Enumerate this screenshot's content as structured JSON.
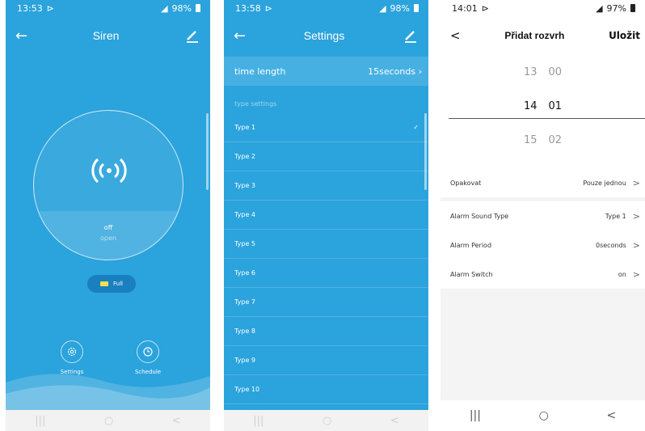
{
  "screen1": {
    "status_time": "13:53",
    "status_right": "98%",
    "title": "Siren",
    "state_main": "off",
    "state_sub": "open",
    "battery_label": "Full",
    "settings_label": "Settings",
    "schedule_label": "Schedule"
  },
  "screen2": {
    "status_time": "13:58",
    "status_right": "98%",
    "title": "Settings",
    "time_length_label": "time length",
    "time_length_value": "15seconds",
    "section_label": "type settings",
    "types": [
      "Type 1",
      "Type 2",
      "Type 3",
      "Type 4",
      "Type 5",
      "Type 6",
      "Type 7",
      "Type 8",
      "Type 9",
      "Type 10"
    ],
    "checkmark": "✓"
  },
  "screen3": {
    "status_time": "14:01",
    "status_right": "97%",
    "title": "Přidat rozvrh",
    "save_label": "Uložit",
    "picker": {
      "top": {
        "h": "13",
        "m": "00"
      },
      "selected": {
        "h": "14",
        "m": "01"
      },
      "bottom": {
        "h": "15",
        "m": "02"
      }
    },
    "repeat_label": "Opakovat",
    "repeat_value": "Pouze jednou",
    "rows": [
      {
        "label": "Alarm Sound Type",
        "value": "Type 1"
      },
      {
        "label": "Alarm Period",
        "value": "0seconds"
      },
      {
        "label": "Alarm Switch",
        "value": "on"
      }
    ]
  },
  "sysnav": {
    "recent": "|||",
    "home": "○",
    "back": "<"
  },
  "colors": {
    "primary": "#2ba3dc",
    "row": "#46b0e2",
    "accent": "#f6e04a"
  }
}
